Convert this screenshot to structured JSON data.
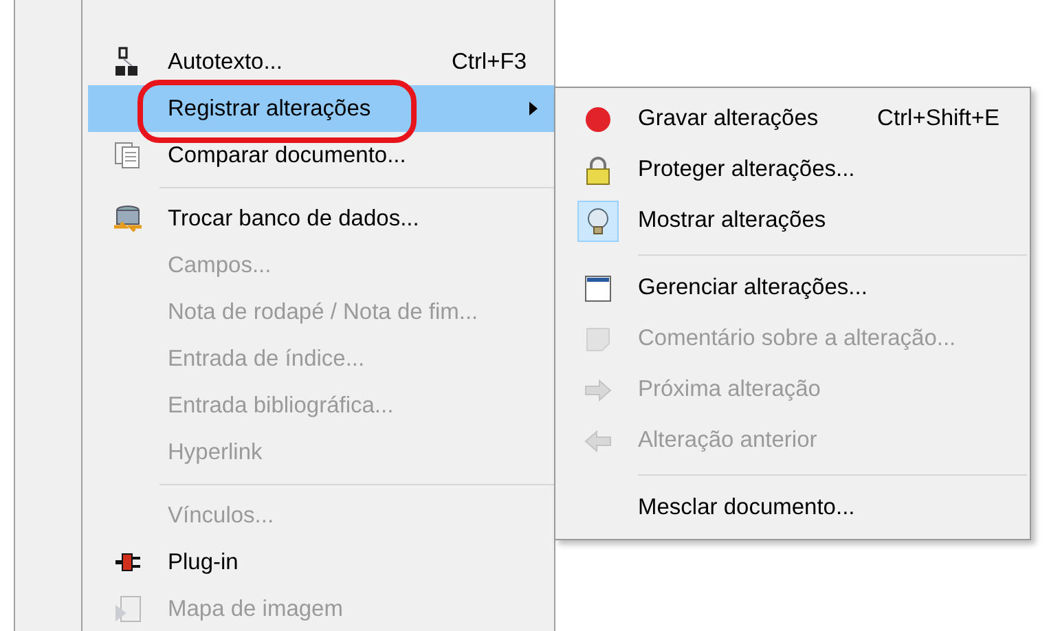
{
  "menu": {
    "items": [
      {
        "kind": "item",
        "label": "Autotexto...",
        "shortcut": "Ctrl+F3",
        "disabled": false,
        "selected": false,
        "has_submenu": false
      },
      {
        "kind": "item",
        "label": "Registrar alterações",
        "disabled": false,
        "selected": true,
        "has_submenu": true
      },
      {
        "kind": "item",
        "label": "Comparar documento...",
        "disabled": false,
        "selected": false,
        "has_submenu": false
      },
      {
        "kind": "separator"
      },
      {
        "kind": "item",
        "label": "Trocar banco de dados...",
        "disabled": false,
        "selected": false,
        "has_submenu": false
      },
      {
        "kind": "item",
        "label": "Campos...",
        "disabled": true,
        "selected": false,
        "has_submenu": false
      },
      {
        "kind": "item",
        "label": "Nota de rodapé / Nota de fim...",
        "disabled": true,
        "selected": false,
        "has_submenu": false
      },
      {
        "kind": "item",
        "label": "Entrada de índice...",
        "disabled": true,
        "selected": false,
        "has_submenu": false
      },
      {
        "kind": "item",
        "label": "Entrada bibliográfica...",
        "disabled": true,
        "selected": false,
        "has_submenu": false
      },
      {
        "kind": "item",
        "label": "Hyperlink",
        "disabled": true,
        "selected": false,
        "has_submenu": false
      },
      {
        "kind": "separator"
      },
      {
        "kind": "item",
        "label": "Vínculos...",
        "disabled": true,
        "selected": false,
        "has_submenu": false
      },
      {
        "kind": "item",
        "label": "Plug-in",
        "disabled": false,
        "selected": false,
        "has_submenu": false
      },
      {
        "kind": "item",
        "label": "Mapa de imagem",
        "disabled": true,
        "selected": false,
        "has_submenu": false
      }
    ]
  },
  "submenu": {
    "items": [
      {
        "kind": "item",
        "label": "Gravar alterações",
        "shortcut": "Ctrl+Shift+E",
        "disabled": false,
        "checked": false
      },
      {
        "kind": "item",
        "label": "Proteger alterações...",
        "disabled": false,
        "checked": false
      },
      {
        "kind": "item",
        "label": "Mostrar alterações",
        "disabled": false,
        "checked": true
      },
      {
        "kind": "separator"
      },
      {
        "kind": "item",
        "label": "Gerenciar alterações...",
        "disabled": false,
        "checked": false
      },
      {
        "kind": "item",
        "label": "Comentário sobre a alteração...",
        "disabled": true,
        "checked": false
      },
      {
        "kind": "item",
        "label": "Próxima alteração",
        "disabled": true,
        "checked": false
      },
      {
        "kind": "item",
        "label": "Alteração anterior",
        "disabled": true,
        "checked": false
      },
      {
        "kind": "separator"
      },
      {
        "kind": "item",
        "label": "Mesclar documento...",
        "disabled": false,
        "checked": false
      }
    ]
  }
}
